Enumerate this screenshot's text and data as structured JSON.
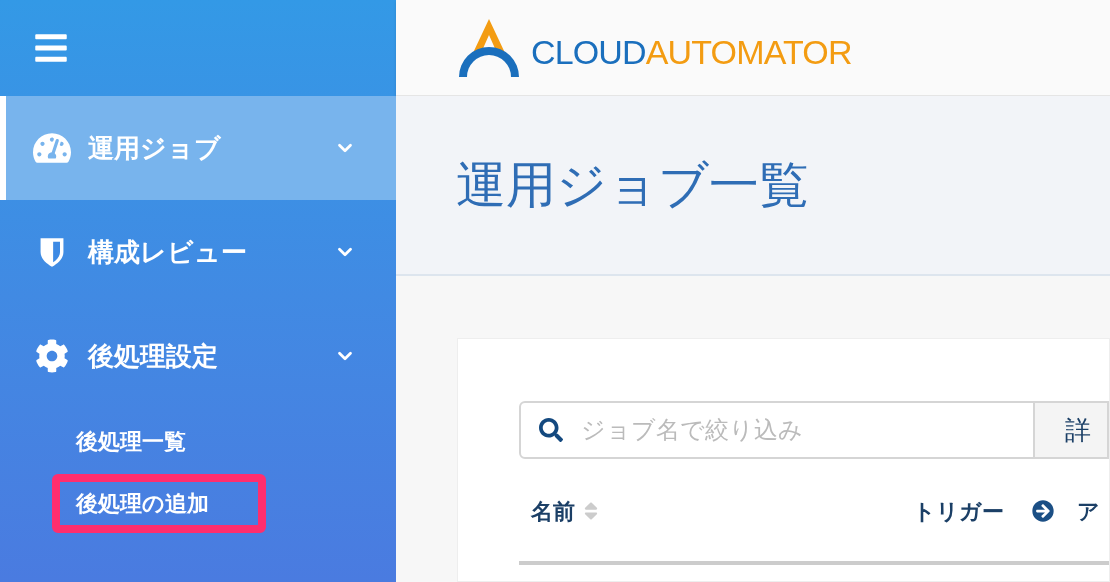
{
  "header": {
    "logo": {
      "part_1": "CLOUD",
      "part_2": "AUTOMATOR"
    }
  },
  "sidebar": {
    "items": [
      {
        "kind": "gauge",
        "label": "運用ジョブ",
        "selected": true
      },
      {
        "kind": "shield",
        "label": "構成レビュー",
        "selected": false
      },
      {
        "kind": "gear",
        "label": "後処理設定",
        "selected": false,
        "children": [
          {
            "label": "後処理一覧",
            "highlighted": false
          },
          {
            "label": "後処理の追加",
            "highlighted": true
          }
        ]
      }
    ]
  },
  "page": {
    "title": "運用ジョブ一覧"
  },
  "search": {
    "placeholder": "ジョブ名で絞り込み",
    "button": "詳"
  },
  "table": {
    "columns": [
      {
        "label": "名前",
        "kind": "sortable"
      },
      {
        "label": "トリガー",
        "kind": "arrow"
      },
      {
        "label": "ア",
        "kind": "plain"
      }
    ]
  }
}
